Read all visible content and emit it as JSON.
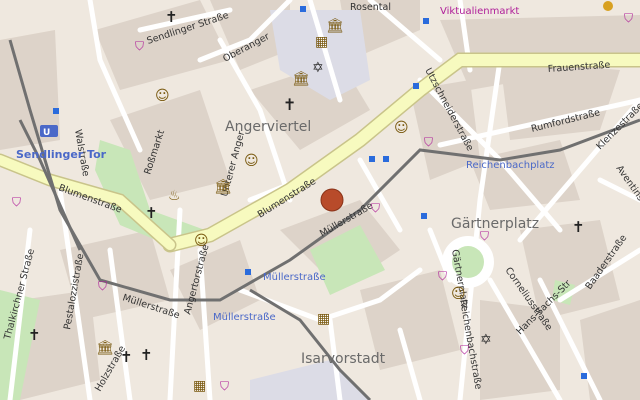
{
  "map": {
    "districts": {
      "angerviertel": "Angerviertel",
      "gaertnerplatz": "Gärtnerplatz",
      "isarvorstadt": "Isarvorstadt"
    },
    "streets": {
      "sendlinger_str": "Sendlinger Straße",
      "oberanger": "Oberanger",
      "rosental": "Rosental",
      "frauenstr": "Frauenstraße",
      "utzschneiderstr": "Utzschneiderstraße",
      "rumfordstr": "Rumfordstraße",
      "klenzestr": "Klenzestraße",
      "aventinstr": "Aventinstr",
      "blumenstr_1": "Blumenstraße",
      "blumenstr_2": "Blumenstraße",
      "muellerstr_1": "Müllerstraße",
      "muellerstr_2": "Müllerstraße",
      "unterer_anger": "Unterer Anger",
      "rossmarkt": "Roßmarkt",
      "angertorstr": "Angertorstraße",
      "walsrstr": "Walstraße",
      "thalkirchner": "Thalkirchner Straße",
      "pestalozzistr": "Pestalozzistraße",
      "holzstr": "Holzstraße",
      "gaertnerplatz_road": "Gärtnerplatz",
      "corneliusstr": "Corneliusstraße",
      "baaderstr": "Baaderstraße",
      "reichenbachstr": "Reichenbachstraße",
      "hans_sachs": "Hans-Sachs-Str"
    },
    "stops": {
      "sendlinger_tor": "Sendlinger Tor",
      "reichenbachplatz": "Reichenbachplatz",
      "muellerstr_stop_1": "Müllerstraße",
      "muellerstr_stop_2": "Müllerstraße",
      "viktualienmarkt": "Viktualienmarkt"
    },
    "colors": {
      "background": "#efe8df",
      "block": "#dcd2c8",
      "road_major": "#f7fabf",
      "road_minor": "#ffffff",
      "tram": "#707070",
      "park": "#c8e6b8",
      "plaza": "#dedee8",
      "marker": "#b84b2a",
      "transit_label": "#4a68c8",
      "district_label": "#6a6a6a",
      "pink_shop": "#b0209a",
      "poi_brown": "#7a5a10"
    },
    "icons": [
      "church-icon",
      "theatre-icon",
      "cinema-icon",
      "museum-icon",
      "shop-icon",
      "synagogue-icon",
      "fire-icon",
      "bus-stop-icon",
      "location-marker-icon"
    ]
  }
}
